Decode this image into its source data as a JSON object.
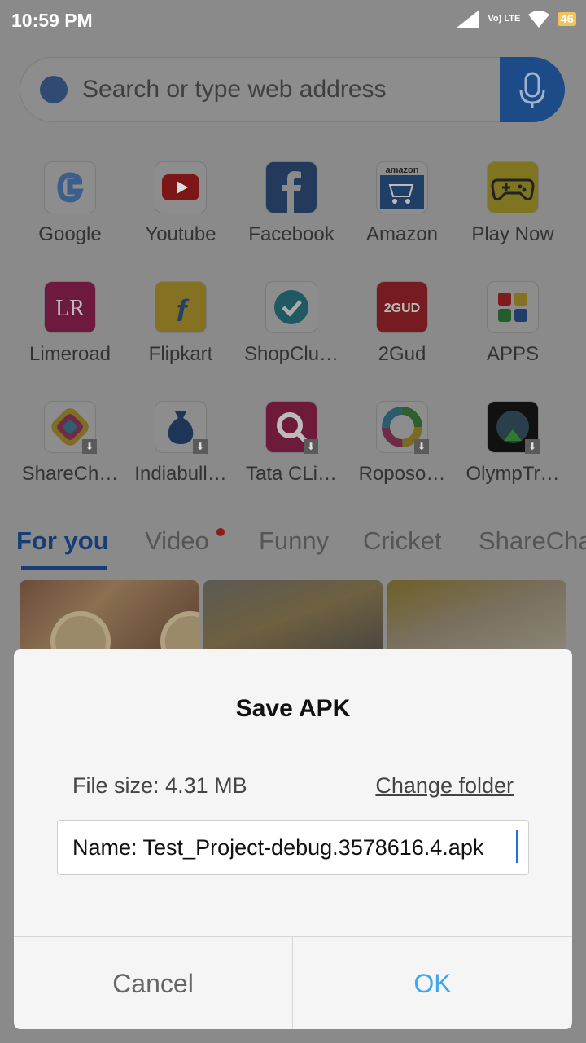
{
  "status_bar": {
    "time": "10:59 PM",
    "network": "Vo) LTE",
    "battery": "46"
  },
  "search": {
    "placeholder": "Search or type web address"
  },
  "shortcuts": [
    {
      "label": "Google",
      "icon": "google-icon"
    },
    {
      "label": "Youtube",
      "icon": "youtube-icon"
    },
    {
      "label": "Facebook",
      "icon": "facebook-icon"
    },
    {
      "label": "Amazon",
      "icon": "amazon-icon",
      "brand_text": "amazon"
    },
    {
      "label": "Play Now",
      "icon": "gamepad-icon"
    },
    {
      "label": "Limeroad",
      "icon": "limeroad-icon",
      "brand_text": "LR"
    },
    {
      "label": "Flipkart",
      "icon": "flipkart-icon",
      "brand_text": "f"
    },
    {
      "label": "ShopClu…",
      "icon": "shopclues-icon"
    },
    {
      "label": "2Gud",
      "icon": "2gud-icon",
      "brand_text": "2GUD"
    },
    {
      "label": "APPS",
      "icon": "apps-grid-icon"
    },
    {
      "label": "ShareCh…",
      "icon": "sharechat-icon"
    },
    {
      "label": "Indiabull…",
      "icon": "indiabulls-icon"
    },
    {
      "label": "Tata CLi…",
      "icon": "tatacliq-icon"
    },
    {
      "label": "Roposo…",
      "icon": "roposo-icon"
    },
    {
      "label": "OlympTr…",
      "icon": "olymptrade-icon"
    }
  ],
  "tabs": [
    {
      "label": "For you",
      "active": true
    },
    {
      "label": "Video"
    },
    {
      "label": "Funny"
    },
    {
      "label": "Cricket"
    },
    {
      "label": "ShareCha"
    }
  ],
  "dialog": {
    "title": "Save APK",
    "file_size_label": "File size:",
    "file_size_value": "4.31 MB",
    "change_folder": "Change folder",
    "name_value": "Name: Test_Project-debug.3578616.4.apk",
    "cancel": "Cancel",
    "ok": "OK"
  },
  "colors": {
    "scrim": "#8a8a8a",
    "accent": "#163e75",
    "ok_button": "#3fa5f0",
    "dialog_bg": "#f5f5f5"
  }
}
